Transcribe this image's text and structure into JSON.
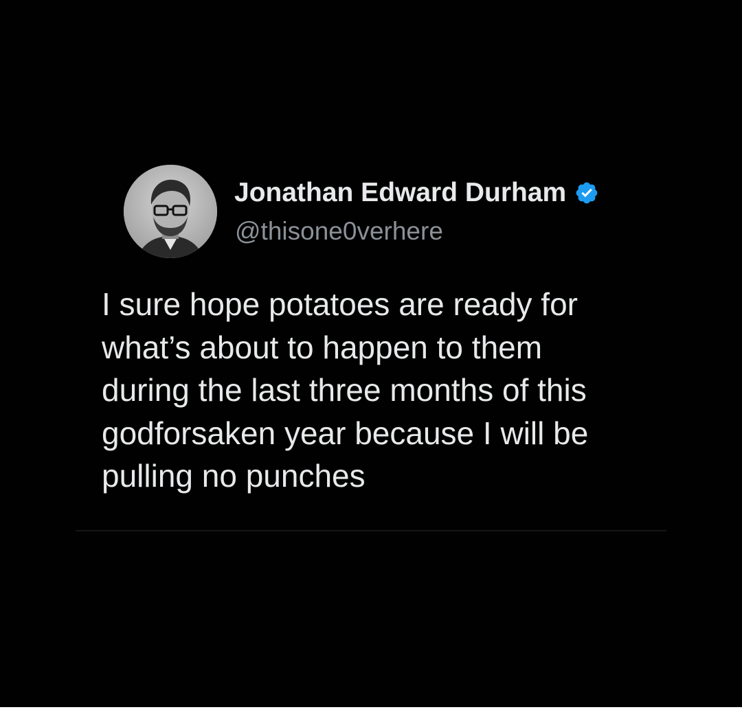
{
  "tweet": {
    "author": {
      "display_name": "Jonathan Edward Durham",
      "handle": "@thisone0verhere",
      "verified": true,
      "verified_icon": "verified-badge-icon",
      "avatar": "profile-photo-avatar"
    },
    "text": "I sure hope potatoes are ready for\nwhat’s about to happen to them\nduring the last three months of this\ngodforsaken year because I will be\npulling no punches"
  },
  "colors": {
    "background": "#010101",
    "primary_text": "#e7e9ea",
    "secondary_text": "#8b9197",
    "verified_blue": "#1d9bf0",
    "bottom_strip": "#ffffff"
  }
}
